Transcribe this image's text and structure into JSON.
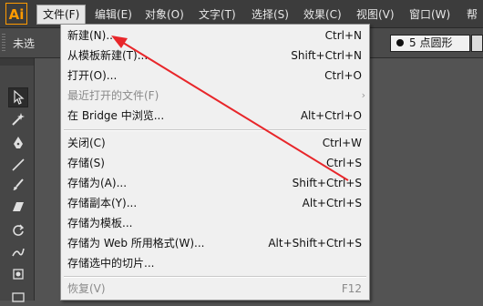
{
  "app": {
    "logo": "Ai"
  },
  "menubar": {
    "items": [
      {
        "label": "文件(F)",
        "active": true
      },
      {
        "label": "编辑(E)"
      },
      {
        "label": "对象(O)"
      },
      {
        "label": "文字(T)"
      },
      {
        "label": "选择(S)"
      },
      {
        "label": "效果(C)"
      },
      {
        "label": "视图(V)"
      },
      {
        "label": "窗口(W)"
      },
      {
        "label": "帮"
      }
    ]
  },
  "control_bar": {
    "selection_label": "未选",
    "brush": "5 点圆形"
  },
  "file_menu": {
    "items": [
      {
        "label": "新建(N)...",
        "shortcut": "Ctrl+N"
      },
      {
        "label": "从模板新建(T)...",
        "shortcut": "Shift+Ctrl+N"
      },
      {
        "label": "打开(O)...",
        "shortcut": "Ctrl+O"
      },
      {
        "label": "最近打开的文件(F)",
        "shortcut": "",
        "disabled": true,
        "submenu": "›"
      },
      {
        "label": "在 Bridge 中浏览...",
        "shortcut": "Alt+Ctrl+O"
      },
      {
        "label": "关闭(C)",
        "shortcut": "Ctrl+W"
      },
      {
        "label": "存储(S)",
        "shortcut": "Ctrl+S"
      },
      {
        "label": "存储为(A)...",
        "shortcut": "Shift+Ctrl+S"
      },
      {
        "label": "存储副本(Y)...",
        "shortcut": "Alt+Ctrl+S"
      },
      {
        "label": "存储为模板...",
        "shortcut": ""
      },
      {
        "label": "存储为 Web 所用格式(W)...",
        "shortcut": "Alt+Shift+Ctrl+S"
      },
      {
        "label": "存储选中的切片...",
        "shortcut": ""
      },
      {
        "label": "恢复(V)",
        "shortcut": "F12",
        "disabled": true
      }
    ]
  },
  "annotation": {
    "color": "#e8262a"
  },
  "colors": {
    "accent_logo": "#ff9a00"
  }
}
